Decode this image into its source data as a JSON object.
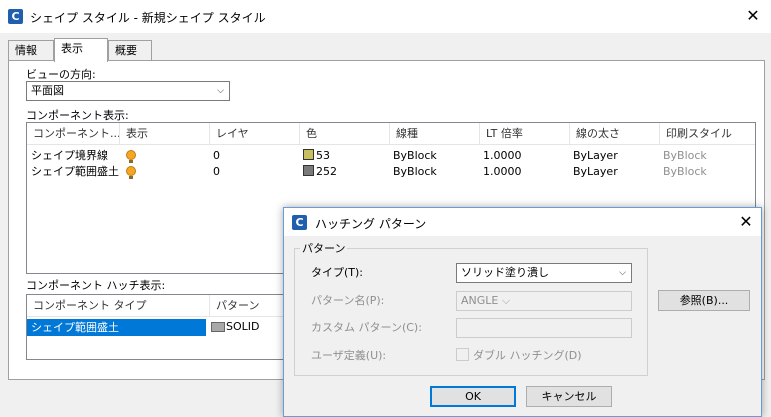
{
  "window": {
    "icon": "C",
    "title": "シェイプ スタイル - 新規シェイプ スタイル"
  },
  "tabs": [
    {
      "label": "情報"
    },
    {
      "label": "表示"
    },
    {
      "label": "概要"
    }
  ],
  "view_direction": {
    "label": "ビューの方向:",
    "value": "平面図"
  },
  "component_display": {
    "label": "コンポーネント表示:",
    "columns": [
      "コンポーネント...",
      "表示",
      "レイヤ",
      "色",
      "線種",
      "LT 倍率",
      "線の太さ",
      "印刷スタイル"
    ],
    "rows": [
      {
        "component": "シェイプ境界線",
        "layer": "0",
        "color_index": "53",
        "color_hex": "#c8c060",
        "linetype": "ByBlock",
        "lt_scale": "1.0000",
        "lineweight": "ByLayer",
        "plot_style": "ByBlock"
      },
      {
        "component": "シェイプ範囲盛土",
        "layer": "0",
        "color_index": "252",
        "color_hex": "#7a7a7a",
        "linetype": "ByBlock",
        "lt_scale": "1.0000",
        "lineweight": "ByLayer",
        "plot_style": "ByBlock"
      }
    ]
  },
  "hatch_display": {
    "label": "コンポーネント ハッチ表示:",
    "columns": [
      "コンポーネント タイプ",
      "パターン"
    ],
    "rows": [
      {
        "component": "シェイプ範囲盛土",
        "pattern": "SOLID"
      }
    ]
  },
  "hatch_dialog": {
    "icon": "C",
    "title": "ハッチング パターン",
    "group_label": "パターン",
    "type_label": "タイプ(T):",
    "type_value": "ソリッド塗り潰し",
    "pattern_name_label": "パターン名(P):",
    "pattern_name_value": "ANGLE",
    "custom_pattern_label": "カスタム パターン(C):",
    "custom_pattern_value": "",
    "user_defined_label": "ユーザ定義(U):",
    "double_hatch_label": "ダブル ハッチング(D)",
    "browse_label": "参照(B)...",
    "ok_label": "OK",
    "cancel_label": "キャンセル"
  }
}
